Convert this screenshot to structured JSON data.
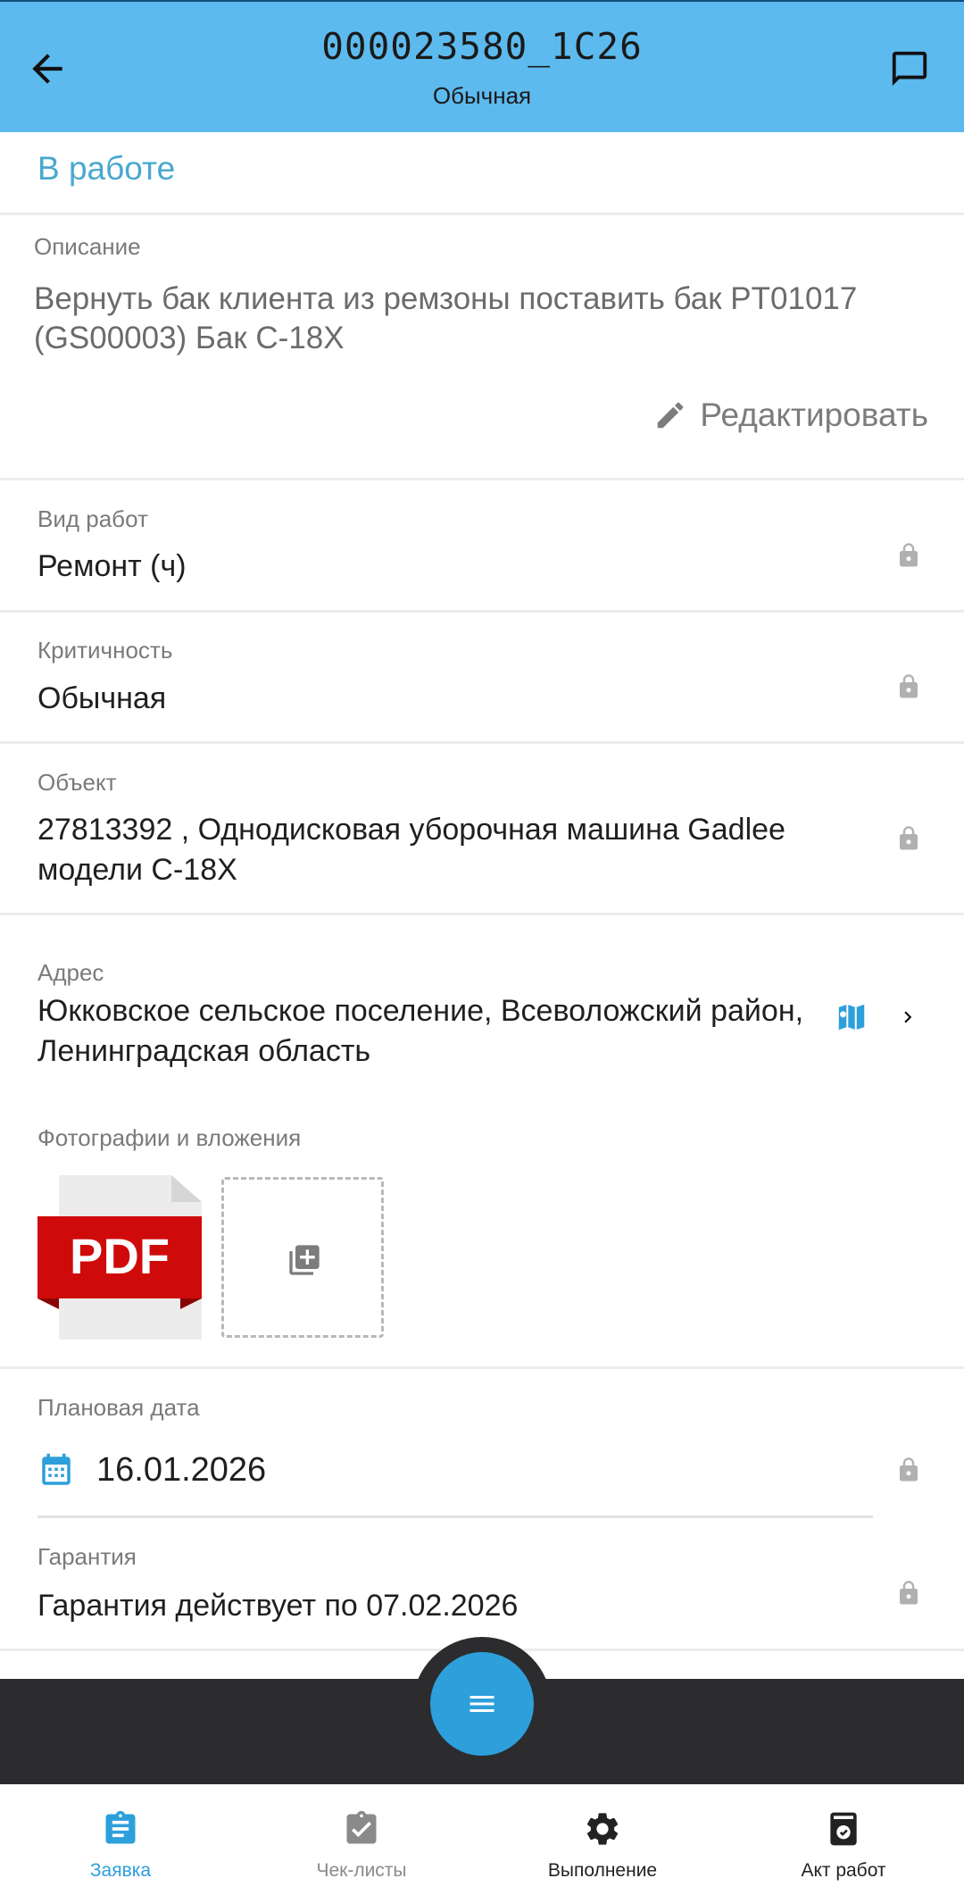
{
  "header": {
    "title": "000023580_1C26",
    "subtitle": "Обычная",
    "back_icon": "arrow-left-icon",
    "chat_icon": "chat-icon",
    "background": "#5dbaee"
  },
  "status": {
    "text": "В работе",
    "color": "#49a8cf"
  },
  "description": {
    "label": "Описание",
    "text": "Вернуть бак клиента из ремзоны поставить бак PT01017 (GS00003) Бак C-18X",
    "edit_label": "Редактировать"
  },
  "fields": {
    "work_type": {
      "label": "Вид работ",
      "value": "Ремонт (ч)"
    },
    "criticality": {
      "label": "Критичность",
      "value": "Обычная"
    },
    "object": {
      "label": "Объект",
      "value": "27813392 , Однодисковая уборочная машина Gadlee модели C-18X"
    },
    "address": {
      "label": "Адрес",
      "value": "Юкковское сельское поселение, Всеволожский район, Ленинградская область"
    },
    "attachments": {
      "label": "Фотографии и вложения",
      "pdf_text": "PDF"
    },
    "planned_date": {
      "label": "Плановая дата",
      "value": "16.01.2026"
    },
    "warranty": {
      "label": "Гарантия",
      "value": "Гарантия действует по 07.02.2026"
    }
  },
  "bottom_nav": {
    "tabs": [
      {
        "label": "Заявка",
        "icon": "clipboard-icon",
        "active": true
      },
      {
        "label": "Чек-листы",
        "icon": "checklist-icon",
        "active": false
      },
      {
        "label": "Выполнение",
        "icon": "settings-gear-icon",
        "active": false
      },
      {
        "label": "Акт работ",
        "icon": "act-check-icon",
        "active": false
      }
    ],
    "active_color": "#2d9fdb",
    "fab_icon": "menu-icon"
  }
}
